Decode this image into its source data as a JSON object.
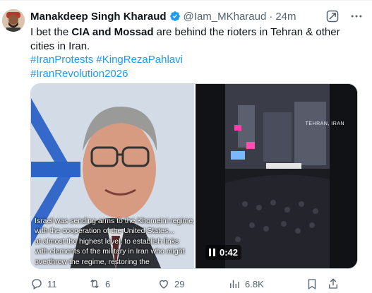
{
  "author": {
    "name": "Manakdeep Singh Kharaud",
    "handle": "@Iam_MKharaud",
    "separator": "·",
    "time": "24m"
  },
  "tweet": {
    "text_intro": "I bet the ",
    "text_bold": "CIA and Mossad",
    "text_rest": " are behind the rioters in Tehran & other cities in Iran.",
    "hashtags": [
      "#IranProtests",
      "#KingRezaPahlavi",
      "#IranRevolution2026"
    ]
  },
  "media": {
    "left_caption_lines": [
      "Israel was sending arms to the Khomeini regime,",
      "with the cooperation of the United States...",
      "at almost the highest level, to establish links",
      "with elements of the military in Iran who might",
      "overthrow the regime, restoring the"
    ],
    "right_watermark": "TEHRAN, IRAN",
    "video_time": "0:42"
  },
  "actions": {
    "replies": "11",
    "reposts": "6",
    "likes": "29",
    "views": "6.8K"
  },
  "colors": {
    "accent": "#1d9bf0",
    "text": "#0f1419",
    "secondary": "#536471",
    "verified": "#1d9bf0"
  },
  "icons": [
    "verified-badge-icon",
    "grok-icon",
    "more-icon",
    "reply-icon",
    "repost-icon",
    "like-icon",
    "views-icon",
    "bookmark-icon",
    "share-icon",
    "pause-icon"
  ]
}
